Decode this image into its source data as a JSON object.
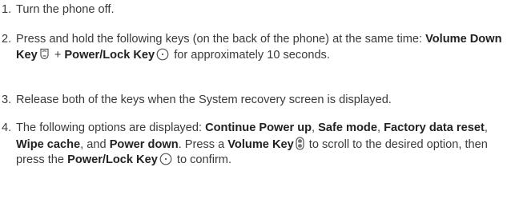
{
  "steps": [
    {
      "num": "1.",
      "text": "Turn the phone off."
    },
    {
      "num": "2.",
      "t1": "Press and hold the following keys (on the back of the phone) at the same time: ",
      "k1": "Volume Down Key",
      "plus": " + ",
      "k2": "Power/Lock Key",
      "t2": " for approximately 10 seconds.",
      "icons": [
        "volume-down-key-icon",
        "power-lock-key-icon"
      ]
    },
    {
      "num": "3.",
      "text": "Release both of the keys when the System recovery screen is displayed."
    },
    {
      "num": "4.",
      "t1": "The following options are displayed: ",
      "o1": "Continue Power up",
      "c1": ", ",
      "o2": "Safe mode",
      "c2": ", ",
      "o3": "Factory data reset",
      "c3": ", ",
      "o4": "Wipe cache",
      "c4": ", and ",
      "o5": "Power down",
      "t2": ". Press a ",
      "k1": "Volume Key",
      "t3": " to scroll to the desired option, then press the ",
      "k2": "Power/Lock Key",
      "t4": " to confirm.",
      "icons": [
        "volume-key-icon",
        "power-lock-key-icon"
      ]
    }
  ]
}
